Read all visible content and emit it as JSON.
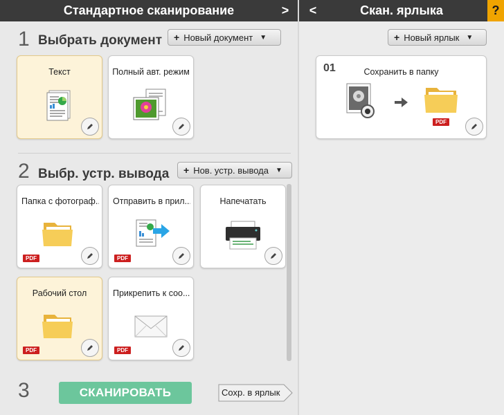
{
  "left_header": {
    "title": "Стандартное сканирование",
    "chevron": ">"
  },
  "right_header": {
    "title": "Скан. ярлыка",
    "chevron": "<",
    "help": "?"
  },
  "step1": {
    "number": "1",
    "title": "Выбрать документ",
    "new_button": "Новый документ",
    "plus": "+",
    "caret": "▼"
  },
  "documents": [
    {
      "label": "Текст",
      "icon": "text-document-icon",
      "selected": true
    },
    {
      "label": "Полный авт. режим",
      "icon": "photo-document-icon",
      "selected": false
    }
  ],
  "step2": {
    "number": "2",
    "title": "Выбр. устр. вывода",
    "new_button": "Нов. устр. вывода",
    "plus": "+",
    "caret": "▼"
  },
  "outputs": [
    {
      "label": "Папка с фотограф...",
      "icon": "folder-icon",
      "badge": "PDF",
      "selected": false
    },
    {
      "label": "Отправить в прил...",
      "icon": "send-to-app-icon",
      "badge": "PDF",
      "selected": false
    },
    {
      "label": "Напечатать",
      "icon": "printer-icon",
      "badge": "",
      "selected": false
    },
    {
      "label": "Рабочий стол",
      "icon": "folder-icon",
      "badge": "PDF",
      "selected": true
    },
    {
      "label": "Прикрепить к соо...",
      "icon": "envelope-icon",
      "badge": "PDF",
      "selected": false
    }
  ],
  "step3": {
    "number": "3",
    "scan_button": "СКАНИРОВАТЬ",
    "save_shortcut_button": "Сохр. в ярлык"
  },
  "shortcuts_panel": {
    "new_button": "Новый ярлык",
    "plus": "+",
    "caret": "▼",
    "items": [
      {
        "number": "01",
        "label": "Сохранить в папку",
        "badge": "PDF"
      }
    ]
  },
  "colors": {
    "header": "#3a3a3a",
    "scan": "#6cc69c",
    "help": "#f0a400",
    "pdf": "#cc1f1f",
    "selected": "#fdf3d9"
  }
}
